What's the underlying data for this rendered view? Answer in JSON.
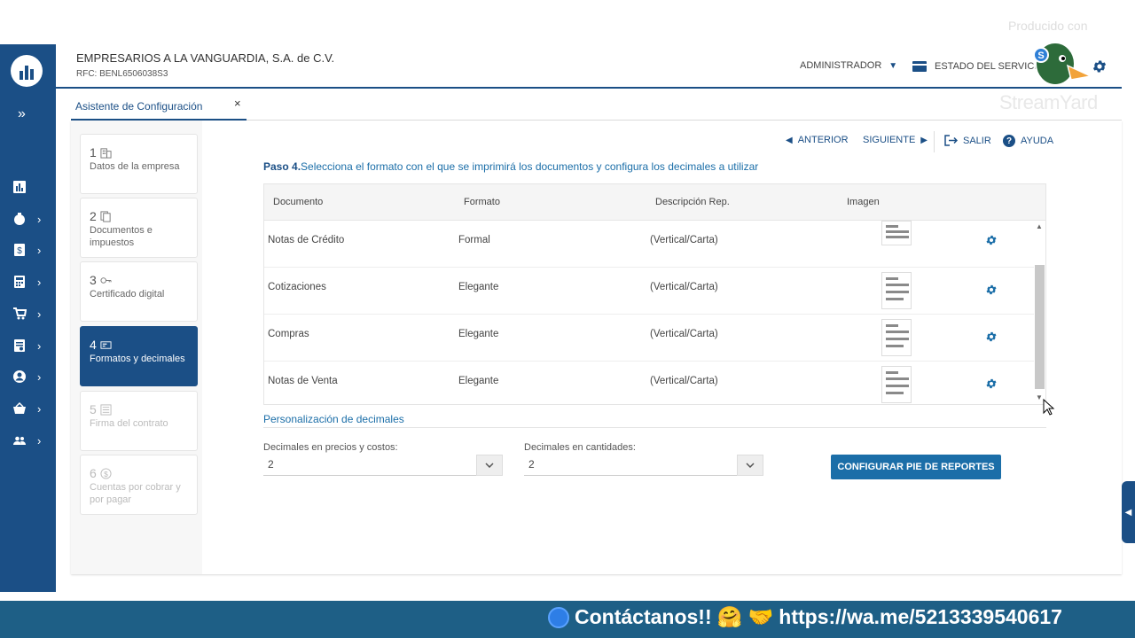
{
  "overlay": {
    "producido": "Producido con",
    "streamyard": "StreamYard"
  },
  "header": {
    "company": "EMPRESARIOS A LA VANGUARDIA, S.A. de C.V.",
    "rfc": "RFC: BENL6506038S3",
    "admin_label": "ADMINISTRADOR",
    "estado_label": "ESTADO DEL SERVICIO"
  },
  "tab": {
    "label": "Asistente de Configuración",
    "close": "×"
  },
  "steps": [
    {
      "num": "1",
      "label": "Datos de la empresa",
      "icon": "building-icon",
      "state": "done"
    },
    {
      "num": "2",
      "label": "Documentos e impuestos",
      "icon": "copy-icon",
      "state": "done"
    },
    {
      "num": "3",
      "label": "Certificado digital",
      "icon": "key-icon",
      "state": "done"
    },
    {
      "num": "4",
      "label": "Formatos y decimales",
      "icon": "card-icon",
      "state": "active"
    },
    {
      "num": "5",
      "label": "Firma del contrato",
      "icon": "list-icon",
      "state": "pending"
    },
    {
      "num": "6",
      "label": "Cuentas por cobrar y por pagar",
      "icon": "dollar-icon",
      "state": "pending"
    }
  ],
  "nav": {
    "anterior": "ANTERIOR",
    "siguiente": "SIGUIENTE",
    "salir": "SALIR",
    "ayuda": "AYUDA"
  },
  "step_title": {
    "bold": "Paso 4.",
    "text": "Selecciona el formato con el que se imprimirá los documentos y configura los decimales a utilizar"
  },
  "table": {
    "headers": [
      "Documento",
      "Formato",
      "Descripción Rep.",
      "Imagen"
    ],
    "rows": [
      {
        "documento": "Notas de Crédito",
        "formato": "Formal",
        "descripcion": "(Vertical/Carta)"
      },
      {
        "documento": "Cotizaciones",
        "formato": "Elegante",
        "descripcion": "(Vertical/Carta)"
      },
      {
        "documento": "Compras",
        "formato": "Elegante",
        "descripcion": "(Vertical/Carta)"
      },
      {
        "documento": "Notas de Venta",
        "formato": "Elegante",
        "descripcion": "(Vertical/Carta)"
      }
    ]
  },
  "decimales": {
    "title": "Personalización de decimales",
    "precios_label": "Decimales en precios y costos:",
    "precios_value": "2",
    "cantidades_label": "Decimales en cantidades:",
    "cantidades_value": "2",
    "button": "CONFIGURAR PIE DE REPORTES"
  },
  "banner": {
    "text": "Contáctanos!!",
    "emojis": "🤗 🤝",
    "url": "https://wa.me/5213339540617"
  },
  "colors": {
    "primary": "#1b4f86",
    "accent": "#1b6ea8",
    "banner": "#1e5f86"
  }
}
